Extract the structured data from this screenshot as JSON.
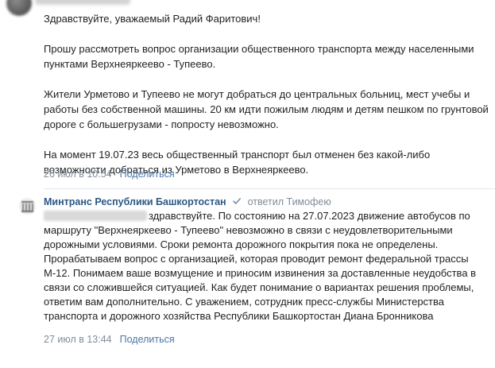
{
  "comment1": {
    "paragraphs": [
      "Здравствуйте, уважаемый Радий Фаритович!",
      "Прошу рассмотреть вопрос организации общественного транспорта между населенными пунктами Верхнеяркеево - Тупеево.",
      "Жители Урметово и Тупеево не могут добраться до центральных больниц, мест учебы и работы без собственной машины. 20 км идти пожилым людям и детям пешком по грунтовой дороге с большегрузами - попросту невозможно.",
      "На момент 19.07.23 весь общественный транспорт был отменен без какой-либо возможности добраться из Урметово в Верхнеяркеево."
    ],
    "date": "26 июл в 10:54",
    "reply_label": "Поделиться"
  },
  "comment2": {
    "author": "Минтранс Республики Башкортостан",
    "replied_to": "ответил Тимофею",
    "text": "здравствуйте. По состоянию на 27.07.2023 движение автобусов по маршруту \"Верхнеяркеево - Тупеево\" невозможно в связи с неудовлетворительными дорожными условиями. Сроки ремонта дорожного покрытия пока не определены. Прорабатываем вопрос с организацией, которая проводит ремонт федеральной трассы М-12. Понимаем ваше возмущение и приносим извинения за доставленные неудобства в связи со сложившейся ситуацией. Как будет понимание о вариантах решения проблемы, ответим вам дополнительно. С уважением, сотрудник пресс-службы Министерства транспорта и дорожного хозяйства Республики Башкортостан Диана Бронникова",
    "date": "27 июл в 13:44",
    "reply_label": "Поделиться"
  },
  "colors": {
    "link": "#2a5885",
    "meta": "#818c99",
    "action": "#4a76a8"
  }
}
